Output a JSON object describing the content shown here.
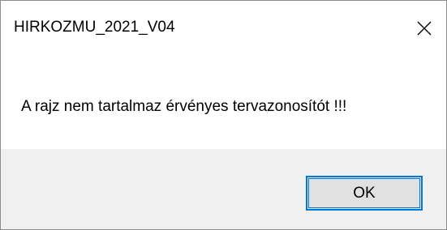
{
  "window": {
    "title": "HIRKOZMU_2021_V04",
    "close_icon": "close-icon"
  },
  "dialog": {
    "message": "A rajz nem tartalmaz érvényes tervazonosítót !!!"
  },
  "buttons": {
    "ok_label": "OK"
  },
  "colors": {
    "footer_background": "#f0f0f0",
    "focus_border": "#0078d7",
    "button_background": "#e1e1e1"
  }
}
